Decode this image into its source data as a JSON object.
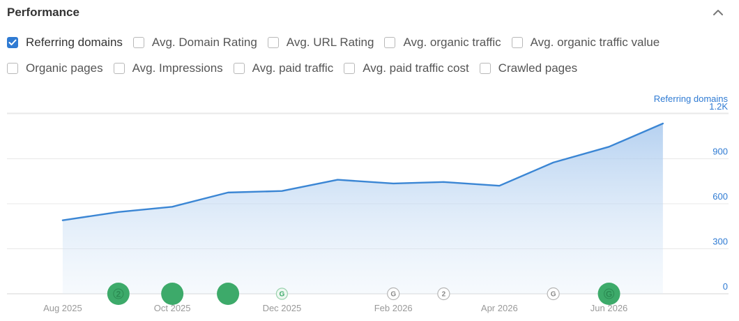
{
  "header": {
    "title": "Performance"
  },
  "metrics": {
    "row1": [
      {
        "label": "Referring domains",
        "checked": true
      },
      {
        "label": "Avg. Domain Rating",
        "checked": false
      },
      {
        "label": "Avg. URL Rating",
        "checked": false
      },
      {
        "label": "Avg. organic traffic",
        "checked": false
      },
      {
        "label": "Avg. organic traffic value",
        "checked": false
      }
    ],
    "row2": [
      {
        "label": "Organic pages",
        "checked": false
      },
      {
        "label": "Avg. Impressions",
        "checked": false
      },
      {
        "label": "Avg. paid traffic",
        "checked": false
      },
      {
        "label": "Avg. paid traffic cost",
        "checked": false
      },
      {
        "label": "Crawled pages",
        "checked": false
      }
    ]
  },
  "colors": {
    "accent": "#2f7bd3",
    "line": "#3b86d4",
    "marker": "#3daa6a"
  },
  "chart_data": {
    "type": "area",
    "series": [
      {
        "name": "Referring domains",
        "x": [
          "2025-08-01",
          "2025-09-01",
          "2025-10-01",
          "2025-11-01",
          "2025-12-01",
          "2026-01-01",
          "2026-02-01",
          "2026-03-01",
          "2026-04-01",
          "2026-05-01",
          "2026-06-01",
          "2026-07-01"
        ],
        "values": [
          490,
          545,
          580,
          675,
          685,
          760,
          735,
          745,
          720,
          875,
          980,
          1135
        ]
      }
    ],
    "x_tick_labels": [
      "Aug 2025",
      "Oct 2025",
      "Dec 2025",
      "Feb 2026",
      "Apr 2026",
      "Jun 2026"
    ],
    "x_tick_dates": [
      "2025-08-01",
      "2025-10-01",
      "2025-12-01",
      "2026-02-01",
      "2026-04-01",
      "2026-06-01"
    ],
    "ylim": [
      0,
      1200
    ],
    "y_ticks": [
      0,
      300,
      600,
      900,
      1200
    ],
    "y_tick_labels": [
      "0",
      "300",
      "600",
      "900",
      "1.2K"
    ],
    "ylabel": "Referring domains",
    "x_range": [
      "2025-07-01",
      "2026-07-22"
    ],
    "grid": true,
    "annotations": [
      {
        "date": "2025-09-01",
        "style": "solid",
        "text": "2"
      },
      {
        "date": "2025-10-01",
        "style": "solid",
        "text": ""
      },
      {
        "date": "2025-11-01",
        "style": "solid",
        "text": ""
      },
      {
        "date": "2025-12-01",
        "style": "light",
        "text": "G"
      },
      {
        "date": "2026-02-01",
        "style": "outline",
        "text": "G"
      },
      {
        "date": "2026-03-01",
        "style": "outline",
        "text": "2"
      },
      {
        "date": "2026-05-01",
        "style": "outline",
        "text": "G"
      },
      {
        "date": "2026-06-01",
        "style": "solid",
        "text": "G"
      }
    ]
  }
}
